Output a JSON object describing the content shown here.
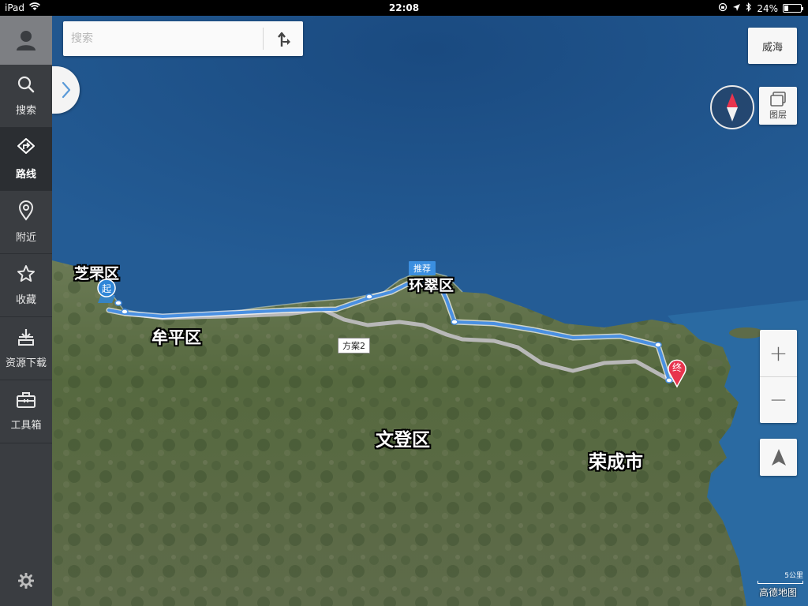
{
  "status_bar": {
    "device": "iPad",
    "time": "22:08",
    "battery": "24%",
    "battery_level": 0.24
  },
  "sidebar": {
    "items": [
      {
        "label": "搜索",
        "icon": "search-icon"
      },
      {
        "label": "路线",
        "icon": "route-icon",
        "active": true
      },
      {
        "label": "附近",
        "icon": "location-pin-icon"
      },
      {
        "label": "收藏",
        "icon": "star-icon"
      },
      {
        "label": "资源下载",
        "icon": "download-icon"
      },
      {
        "label": "工具箱",
        "icon": "toolbox-icon"
      }
    ],
    "settings_icon": "gear-icon"
  },
  "search": {
    "placeholder": "搜索",
    "value": ""
  },
  "controls": {
    "city": "威海",
    "layers_label": "图层",
    "zoom_in": "+",
    "zoom_out": "−"
  },
  "map": {
    "labels": {
      "zhifu": "芝罘区",
      "muping": "牟平区",
      "huancui": "环翠区",
      "wendeng": "文登区",
      "rongcheng": "荣成市"
    },
    "start_marker": "起",
    "end_marker": "终",
    "recommended_route_label": "推荐",
    "alt_route_label": "方案2",
    "scale": "5公里",
    "brand": "高德地图",
    "colors": {
      "recommended_route": "#4a90e2",
      "alt_route": "#b9b9b9",
      "end_pin": "#e8344e",
      "start_pin": "#2f86d8"
    }
  }
}
